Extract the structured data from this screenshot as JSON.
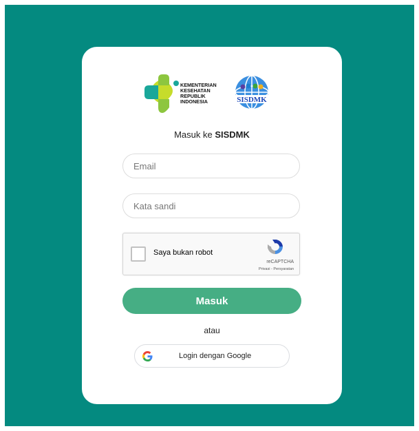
{
  "colors": {
    "background": "#048a80",
    "primary_button": "#46ae84",
    "kemenkes_green": "#8dc63f",
    "kemenkes_teal": "#1aa79a"
  },
  "logos": {
    "kemenkes_text": "KEMENTERIAN KESEHATAN REPUBLIK INDONESIA",
    "sisdmk_text": "SISDMK"
  },
  "login": {
    "title_prefix": "Masuk ke ",
    "title_brand": "SISDMK",
    "email_placeholder": "Email",
    "password_placeholder": "Kata sandi",
    "submit_label": "Masuk",
    "separator": "atau",
    "google_label": "Login dengan Google"
  },
  "recaptcha": {
    "checkbox_label": "Saya bukan robot",
    "brand": "reCAPTCHA",
    "links": "Privasi - Persyaratan"
  },
  "icons": {
    "google": "google-g-icon",
    "recaptcha": "recaptcha-logo-icon"
  }
}
